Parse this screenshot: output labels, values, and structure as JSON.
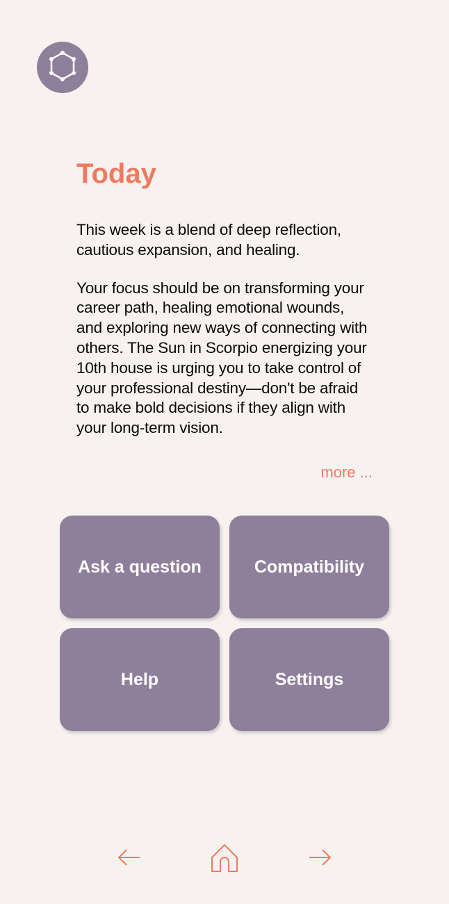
{
  "header": {
    "title": "Today"
  },
  "content": {
    "paragraph1": "This week is a blend of deep reflection, cautious expansion, and healing.",
    "paragraph2": "Your focus should be on transforming your career path, healing emotional wounds, and exploring new ways of connecting with others. The Sun in Scorpio energizing your 10th house is urging you to take control of your professional destiny—don't be afraid to make bold decisions if they align with your long-term vision.",
    "more_label": "more ..."
  },
  "tiles": {
    "ask": "Ask a question",
    "compatibility": "Compatibility",
    "help": "Help",
    "settings": "Settings"
  },
  "icons": {
    "logo": "hexagon-nodes-icon",
    "back": "arrow-left-icon",
    "home": "home-icon",
    "forward": "arrow-right-icon"
  }
}
